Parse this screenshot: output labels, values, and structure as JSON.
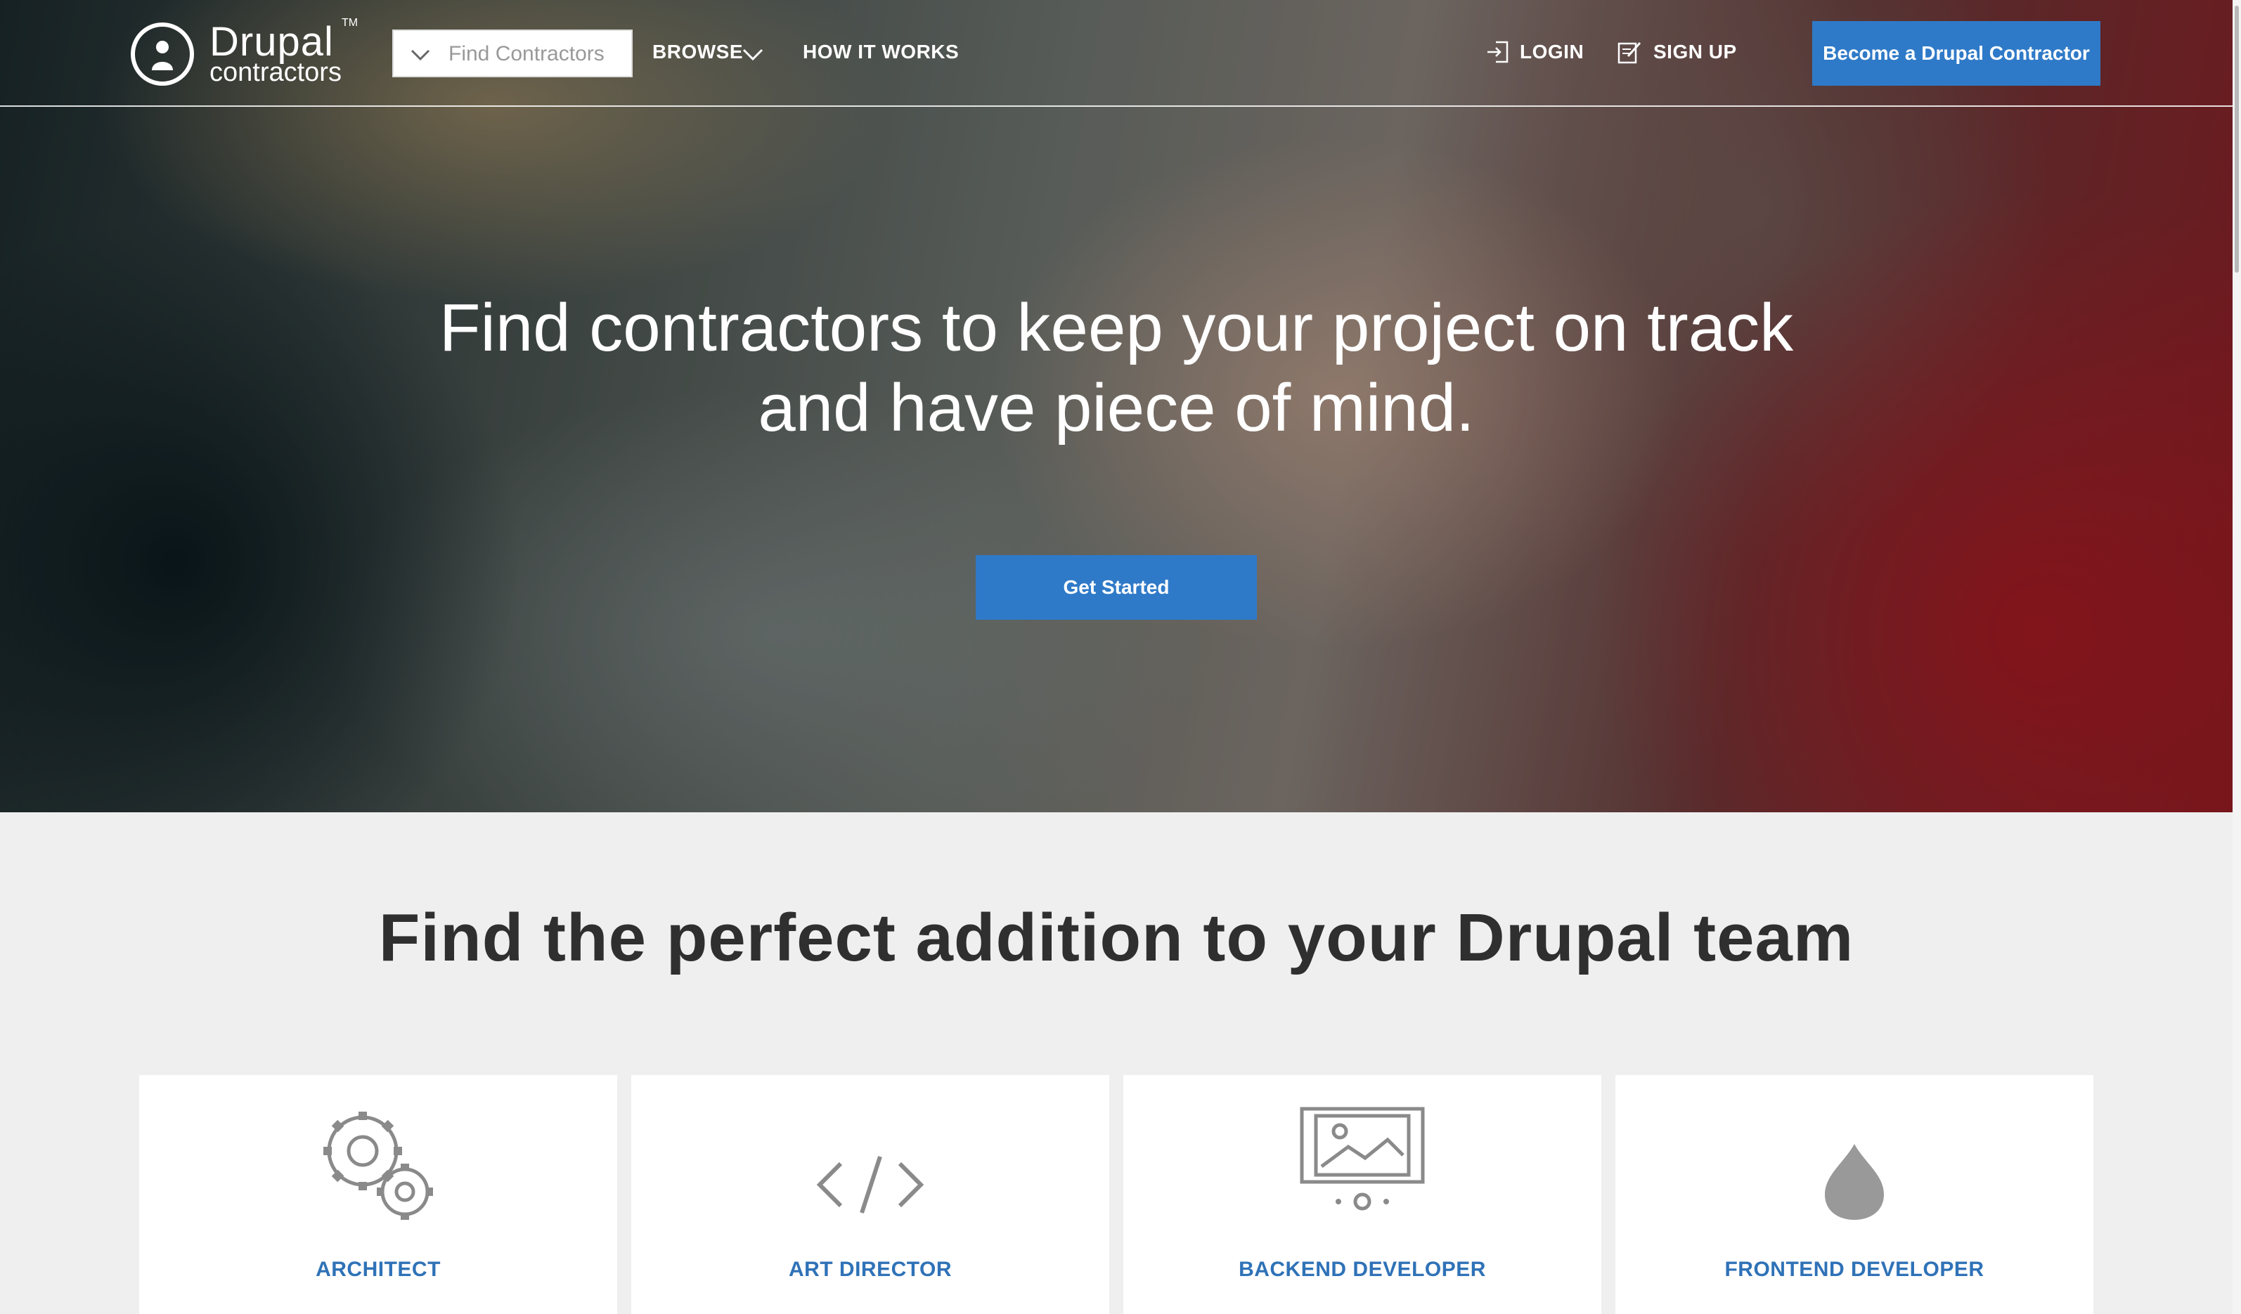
{
  "brand": {
    "name": "Drupal",
    "sub": "contractors",
    "tm": "TM"
  },
  "header": {
    "search_placeholder": "Find Contractors",
    "nav_browse": "BROWSE",
    "nav_how": "HOW IT WORKS",
    "nav_login": "LOGIN",
    "nav_signup": "SIGN UP",
    "cta": "Become a Drupal Contractor"
  },
  "hero": {
    "line1": "Find contractors to keep your project on track",
    "line2": "and have piece of mind.",
    "button": "Get Started"
  },
  "section": {
    "title": "Find the perfect addition to your Drupal team",
    "roles": [
      {
        "label": "ARCHITECT",
        "icon": "gears-icon"
      },
      {
        "label": "ART DIRECTOR",
        "icon": "code-icon"
      },
      {
        "label": "BACKEND DEVELOPER",
        "icon": "image-monitor-icon"
      },
      {
        "label": "FRONTEND DEVELOPER",
        "icon": "drop-icon"
      }
    ]
  },
  "colors": {
    "accent": "#2f7ac8",
    "role_text": "#2f72b7",
    "section_bg": "#efefef"
  }
}
